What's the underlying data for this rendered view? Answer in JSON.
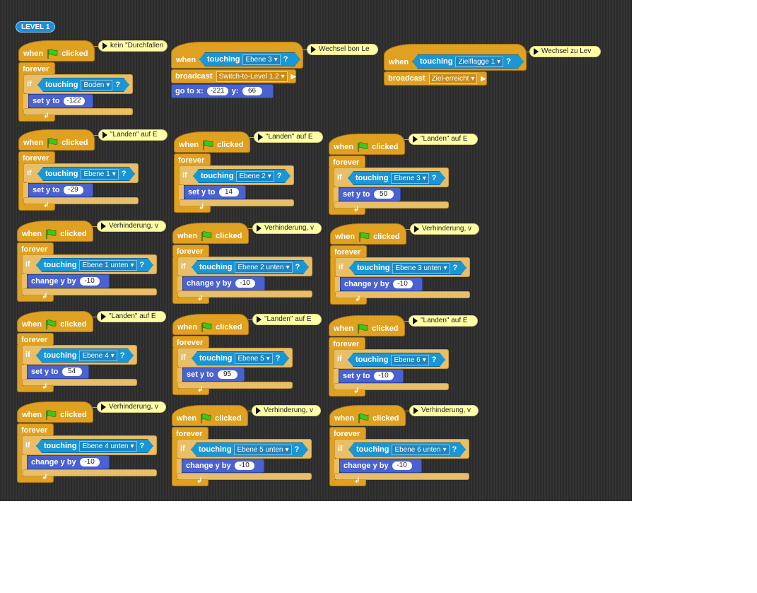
{
  "level_label": "LEVEL 1",
  "colors": {
    "stage_bg": "#2f2f2f",
    "control": "#e0a020",
    "sensing": "#1a96d6",
    "motion": "#4a62d0",
    "comment": "#ffffa5"
  },
  "words": {
    "when": "when",
    "clicked": "clicked",
    "forever": "forever",
    "if": "if",
    "touching": "touching",
    "q": "?",
    "set_y_to": "set y to",
    "change_y_by": "change y by",
    "broadcast": "broadcast",
    "go_to_x": "go to x:",
    "y": "y:"
  },
  "scripts": [
    {
      "comment": "kein \"Durchfallen",
      "touch": "Boden",
      "value": "-122"
    },
    {
      "comment": "Wechsel bon Le",
      "hat_touch": "Ebene 3",
      "broadcast": "Switch-to-Level 1.2",
      "goto_x": "-221",
      "goto_y": "66"
    },
    {
      "comment": "Wechsel zu Lev",
      "hat_touch": "Zielflagge 1",
      "broadcast": "Ziel-erreicht"
    },
    {
      "comment": "\"Landen\" auf E",
      "touch": "Ebene 1",
      "value": "-29"
    },
    {
      "comment": "\"Landen\" auf E",
      "touch": "Ebene 2",
      "value": "14"
    },
    {
      "comment": "\"Landen\" auf E",
      "touch": "Ebene 3",
      "value": "50"
    },
    {
      "comment": "Verhinderung, v",
      "touch": "Ebene 1 unten",
      "value": "-10"
    },
    {
      "comment": "Verhinderung, v",
      "touch": "Ebene 2 unten",
      "value": "-10"
    },
    {
      "comment": "Verhinderung, v",
      "touch": "Ebene 3 unten",
      "value": "-10"
    },
    {
      "comment": "\"Landen\" auf E",
      "touch": "Ebene 4",
      "value": "54"
    },
    {
      "comment": "\"Landen\" auf E",
      "touch": "Ebene 5",
      "value": "95"
    },
    {
      "comment": "\"Landen\" auf E",
      "touch": "Ebene 6",
      "value": "-10"
    },
    {
      "comment": "Verhinderung, v",
      "touch": "Ebene 4 unten",
      "value": "-10"
    },
    {
      "comment": "Verhinderung, v",
      "touch": "Ebene 5 unten",
      "value": "-10"
    },
    {
      "comment": "Verhinderung, v",
      "touch": "Ebene 6 unten",
      "value": "-10"
    }
  ]
}
